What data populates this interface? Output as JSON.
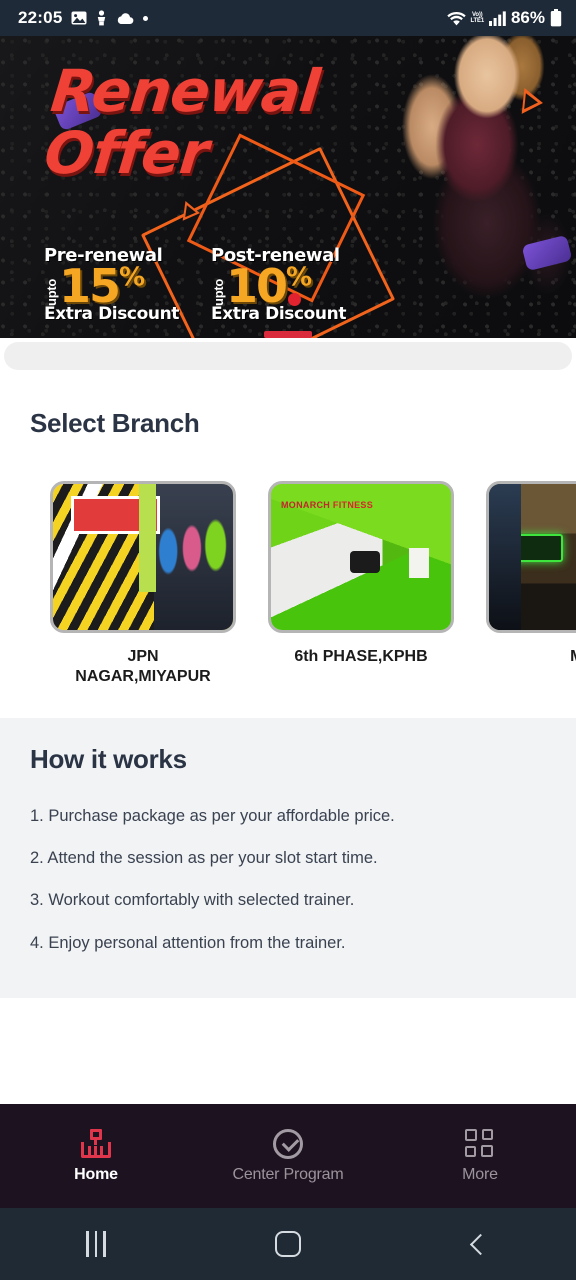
{
  "status_bar": {
    "time": "22:05",
    "icons_left": [
      "image-icon",
      "person-icon",
      "cloud-icon",
      "dot-icon"
    ],
    "volte_top": "Vo))",
    "volte_bottom": "LTE1",
    "battery_percent": "86%",
    "icons_right": [
      "wifi-icon",
      "volte-icon",
      "signal-icon",
      "battery-icon"
    ]
  },
  "banner": {
    "headline_line1": "Renewal",
    "headline_line2": "Offer",
    "offer_pre": {
      "title": "Pre-renewal",
      "upto": "upto",
      "percent": "15",
      "percent_symbol": "%",
      "subtitle": "Extra Discount"
    },
    "offer_post": {
      "title": "Post-renewal",
      "upto": "upto",
      "percent": "10",
      "percent_symbol": "%",
      "subtitle": "Extra Discount"
    },
    "accent_red": "#ef4136",
    "accent_yellow": "#f5a623",
    "accent_orange": "#f0601f",
    "indicator_color": "#d92b3c"
  },
  "branch_section": {
    "title": "Select Branch",
    "branches": [
      {
        "label": "JPN\nNAGAR,MIYAPUR",
        "label_line1": "JPN",
        "label_line2": "NAGAR,MIYAPUR",
        "photo": "gym-interior-photo"
      },
      {
        "label": "6th PHASE,KPHB",
        "label_line1": "6th PHASE,KPHB",
        "label_line2": "",
        "photo": "gym-reception-photo",
        "sign_text": "MONARCH",
        "sign_text2": "FITNESS"
      },
      {
        "label": "MI",
        "label_line1": "MI",
        "label_line2": "",
        "photo": "gym-neon-photo"
      }
    ]
  },
  "how_section": {
    "title": "How it works",
    "steps": [
      "1. Purchase package as per your affordable price.",
      "2. Attend the session as per your slot start time.",
      "3. Workout comfortably with selected trainer.",
      "4. Enjoy personal attention from the trainer."
    ]
  },
  "bottom_nav": {
    "active_color": "#e0354a",
    "inactive_color": "#a39ba4",
    "items": [
      {
        "label": "Home",
        "icon": "home-icon",
        "active": true
      },
      {
        "label": "Center Program",
        "icon": "check-circle-icon",
        "active": false
      },
      {
        "label": "More",
        "icon": "grid-icon",
        "active": false
      }
    ]
  },
  "android_nav": {
    "recents": "recents-icon",
    "home": "android-home-icon",
    "back": "back-icon"
  }
}
